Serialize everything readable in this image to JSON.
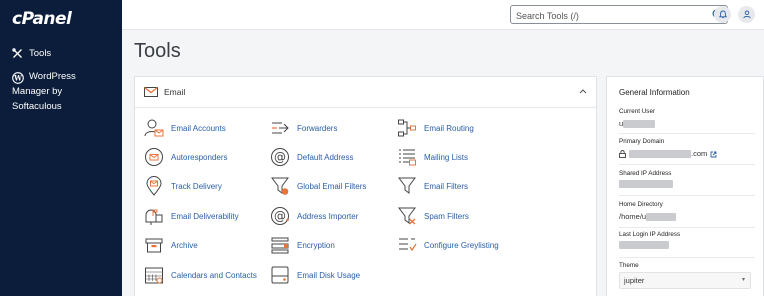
{
  "sidebar": {
    "logo": "cPanel",
    "items": [
      {
        "label": "Tools",
        "icon": "tools-icon"
      },
      {
        "label": "WordPress Manager by Softaculous",
        "icon": "wordpress-icon"
      }
    ]
  },
  "topbar": {
    "search_placeholder": "Search Tools (/)",
    "icons": [
      "search-icon",
      "bell-icon",
      "user-icon"
    ]
  },
  "page": {
    "title": "Tools"
  },
  "email_section": {
    "title": "Email",
    "tools": [
      {
        "label": "Email Accounts",
        "icon": "email-accounts-icon"
      },
      {
        "label": "Forwarders",
        "icon": "forwarders-icon"
      },
      {
        "label": "Email Routing",
        "icon": "email-routing-icon"
      },
      {
        "label": "Autoresponders",
        "icon": "autoresponders-icon"
      },
      {
        "label": "Default Address",
        "icon": "default-address-icon"
      },
      {
        "label": "Mailing Lists",
        "icon": "mailing-lists-icon"
      },
      {
        "label": "Track Delivery",
        "icon": "track-delivery-icon"
      },
      {
        "label": "Global Email Filters",
        "icon": "global-filters-icon"
      },
      {
        "label": "Email Filters",
        "icon": "email-filters-icon"
      },
      {
        "label": "Email Deliverability",
        "icon": "deliverability-icon"
      },
      {
        "label": "Address Importer",
        "icon": "address-importer-icon"
      },
      {
        "label": "Spam Filters",
        "icon": "spam-filters-icon"
      },
      {
        "label": "Archive",
        "icon": "archive-icon"
      },
      {
        "label": "Encryption",
        "icon": "encryption-icon"
      },
      {
        "label": "Configure Greylisting",
        "icon": "greylisting-icon"
      },
      {
        "label": "Calendars and Contacts",
        "icon": "calendars-icon"
      },
      {
        "label": "Email Disk Usage",
        "icon": "disk-usage-icon"
      }
    ]
  },
  "general_info": {
    "title": "General Information",
    "current_user_label": "Current User",
    "current_user_value": "u",
    "primary_domain_label": "Primary Domain",
    "primary_domain_value": ".com",
    "shared_ip_label": "Shared IP Address",
    "home_directory_label": "Home Directory",
    "home_directory_value": "/home/u",
    "last_login_label": "Last Login IP Address",
    "theme_label": "Theme",
    "theme_value": "jupiter"
  },
  "colors": {
    "sidebar_bg": "#0b1d3a",
    "link": "#2a5ea8",
    "accent_orange": "#e8743b"
  }
}
